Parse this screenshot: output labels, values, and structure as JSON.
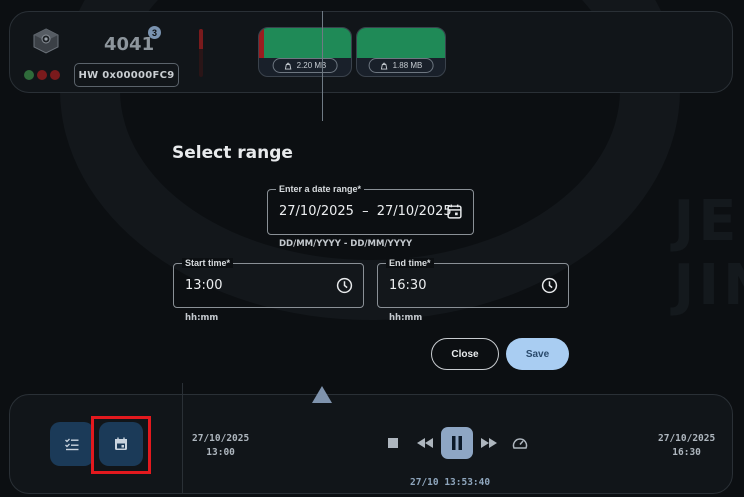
{
  "device": {
    "id": "4041",
    "badge_count": "3",
    "hw_label": "HW 0x00000FC9",
    "status_dots": [
      "#2f6b3a",
      "#7a1a1c",
      "#7a1a1c"
    ]
  },
  "storage_chips": [
    {
      "size": "2.20 MB",
      "fill_color": "#1f8a57",
      "alert_strip": true
    },
    {
      "size": "1.88 MB",
      "fill_color": "#1f8a57",
      "alert_strip": false
    }
  ],
  "dialog": {
    "title": "Select range",
    "date_range": {
      "label": "Enter a date range*",
      "start": "27/10/2025",
      "separator": "–",
      "end": "27/10/2025",
      "hint": "DD/MM/YYYY - DD/MM/YYYY",
      "icon": "calendar-icon"
    },
    "start_time": {
      "label": "Start time*",
      "value": "13:00",
      "hint": "hh:mm",
      "icon": "clock-icon"
    },
    "end_time": {
      "label": "End time*",
      "value": "16:30",
      "hint": "hh:mm",
      "icon": "clock-icon"
    },
    "close_label": "Close",
    "save_label": "Save"
  },
  "timeline": {
    "start_date": "27/10/2025",
    "start_time": "13:00",
    "end_date": "27/10/2025",
    "end_time": "16:30",
    "current": "27/10 13:53:40",
    "controls": [
      "stop-icon",
      "rewind-icon",
      "pause-icon",
      "fast-forward-icon",
      "speed-icon"
    ],
    "view_buttons": [
      "checklist-icon",
      "calendar-icon"
    ]
  },
  "colors": {
    "accent": "#a9cdf2",
    "button_bg": "#1b3a58",
    "highlight": "#e3191e",
    "ok": "#1f8a57",
    "alert": "#9b1c1f"
  }
}
